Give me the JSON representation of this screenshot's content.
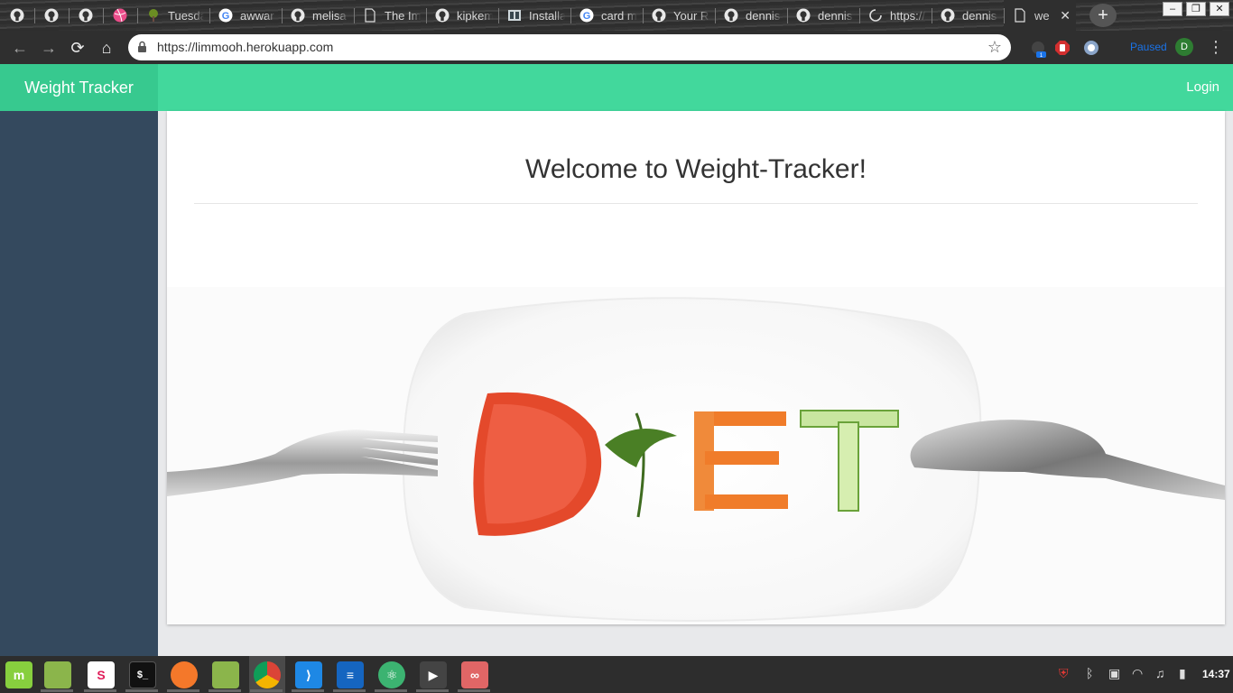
{
  "browser": {
    "tabs": [
      {
        "icon": "github-icon",
        "title": ""
      },
      {
        "icon": "github-icon",
        "title": ""
      },
      {
        "icon": "github-icon",
        "title": ""
      },
      {
        "icon": "dribbble-icon",
        "title": ""
      },
      {
        "icon": "tree-icon",
        "title": "Tuesda"
      },
      {
        "icon": "google-icon",
        "title": "awwar"
      },
      {
        "icon": "github-icon",
        "title": "melisa"
      },
      {
        "icon": "document-icon",
        "title": "The Im"
      },
      {
        "icon": "github-icon",
        "title": "kipkem"
      },
      {
        "icon": "installer-icon",
        "title": "Installa"
      },
      {
        "icon": "google-icon",
        "title": "card m"
      },
      {
        "icon": "github-icon",
        "title": "Your Re"
      },
      {
        "icon": "github-icon",
        "title": "dennis"
      },
      {
        "icon": "github-icon",
        "title": "dennis"
      },
      {
        "icon": "loading-icon",
        "title": "https://"
      },
      {
        "icon": "github-icon",
        "title": "dennis"
      },
      {
        "icon": "document-icon",
        "title": "we"
      }
    ],
    "active_tab_index": 16,
    "new_tab_label": "+",
    "url": "https://limmooh.herokuapp.com",
    "profile_status": "Paused",
    "profile_initial": "D",
    "extension_badge": "1"
  },
  "app": {
    "brand": "Weight Tracker",
    "login": "Login",
    "heading": "Welcome to Weight-Tracker!",
    "colors": {
      "navbar": "#42d89c",
      "brand_bg": "#37c98f",
      "sidebar": "#34495e"
    }
  },
  "taskbar": {
    "apps": [
      "mint-menu-icon",
      "files-icon",
      "slack-icon",
      "terminal-icon",
      "firefox-icon",
      "folder-icon",
      "chrome-icon",
      "vscode-icon",
      "text-editor-icon",
      "atom-icon",
      "media-player-icon",
      "glasses-icon"
    ],
    "clock": "14:37"
  }
}
